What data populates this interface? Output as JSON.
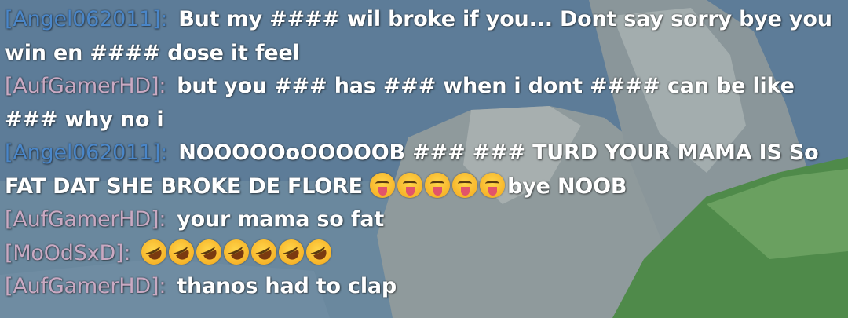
{
  "colors": {
    "angel": "#4a86c8",
    "aufgamer": "#c8a8c0",
    "moodsxd": "#c8a8c0",
    "text": "#ffffff"
  },
  "messages": [
    {
      "name": "[Angel062011]:",
      "name_color": "#4a86c8",
      "text": "But my #### wil broke if you... Dont say sorry bye you win en #### dose it feel",
      "emojis": []
    },
    {
      "name": "[AufGamerHD]:",
      "name_color": "#c9a9c2",
      "text": "but you ### has ### when i dont #### can be like ### why no i",
      "emojis": []
    },
    {
      "name": "[Angel062011]:",
      "name_color": "#4a86c8",
      "text": "NOOOOOoOOOOOB ### ### TURD YOUR MAMA IS So FAT DAT SHE BROKE DE FLORE",
      "emojis": [
        "squinting-tongue-emoji",
        "squinting-tongue-emoji",
        "squinting-tongue-emoji",
        "squinting-tongue-emoji",
        "squinting-tongue-emoji"
      ],
      "suffix": "bye NOOB"
    },
    {
      "name": "[AufGamerHD]:",
      "name_color": "#c9a9c2",
      "text": "your mama so fat",
      "emojis": []
    },
    {
      "name": "[MoOdSxD]:",
      "name_color": "#c9a9c2",
      "text": "",
      "emojis": [
        "rofl-emoji",
        "rofl-emoji",
        "rofl-emoji",
        "rofl-emoji",
        "rofl-emoji",
        "rofl-emoji",
        "rofl-emoji"
      ]
    },
    {
      "name": "[AufGamerHD]:",
      "name_color": "#c9a9c2",
      "text": "thanos had to clap",
      "emojis": []
    }
  ]
}
